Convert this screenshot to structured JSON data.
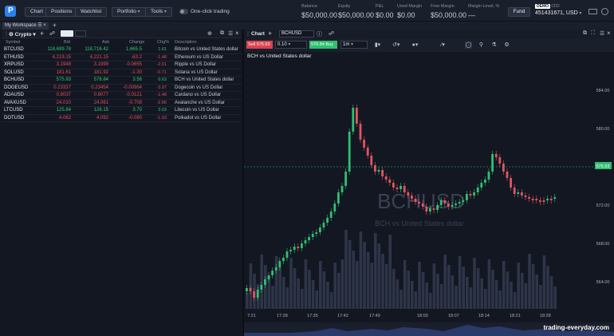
{
  "topbar": {
    "logo": "P",
    "nav": [
      "Chart",
      "Positions",
      "Watchlist"
    ],
    "portfolio": "Portfolio",
    "tools": "Tools",
    "one_click": "One-click trading",
    "balance_label": "Balance",
    "balance": "$50,000.00",
    "equity_label": "Equity",
    "equity": "$50,000.00",
    "pnl_label": "P&L",
    "pnl": "$0.00",
    "used_margin_label": "Used Margin",
    "used_margin": "$0.00",
    "free_margin_label": "Free Margin",
    "free_margin": "$50,000.00",
    "margin_level_label": "Margin Level, %",
    "margin_level": "—",
    "fund": "Fund",
    "demo_badge": "DEMO",
    "demo_suffix": "CFD",
    "account": "451431671, USD"
  },
  "workspace": {
    "tab": "My Workspace"
  },
  "watchlist": {
    "title": "Crypto",
    "columns": [
      "Symbol",
      "Bid",
      "Ask",
      "Change",
      "Chg%",
      "Description"
    ],
    "rows": [
      {
        "symbol": "BTCUSD",
        "bid": "118,699.78",
        "ask": "118,716.42",
        "change": "1,665.5",
        "chg": "1.61",
        "desc": "Bitcoin vs United States dollar",
        "up": true
      },
      {
        "symbol": "ETHUSD",
        "bid": "4,219.15",
        "ask": "4,221.15",
        "change": "-63.2",
        "chg": "-1.48",
        "desc": "Ethereum vs US Dollar",
        "up": false
      },
      {
        "symbol": "XRPUSD",
        "bid": "3.1948",
        "ask": "3.1999",
        "change": "-0.0655",
        "chg": "-2.01",
        "desc": "Ripple vs US Dollar",
        "up": false
      },
      {
        "symbol": "SOLUSD",
        "bid": "181.61",
        "ask": "181.92",
        "change": "-1.30",
        "chg": "-0.71",
        "desc": "Solana vs US Dollar",
        "up": false
      },
      {
        "symbol": "BCHUSD",
        "bid": "575.93",
        "ask": "576.84",
        "change": "3.56",
        "chg": "0.63",
        "desc": "BCH vs United States dollar",
        "up": true
      },
      {
        "symbol": "DOGEUSD",
        "bid": "0.23337",
        "ask": "0.23454",
        "change": "-0.00964",
        "chg": "-3.97",
        "desc": "Dogecoin vs US Dollar",
        "up": false
      },
      {
        "symbol": "ADAUSD",
        "bid": "0.8037",
        "ask": "0.8077",
        "change": "-0.0121",
        "chg": "-1.48",
        "desc": "Cardano vs US Dollar",
        "up": false
      },
      {
        "symbol": "AVAXUSD",
        "bid": "24.010",
        "ask": "24.061",
        "change": "-0.708",
        "chg": "-2.86",
        "desc": "Avalanche vs US Dollar",
        "up": false
      },
      {
        "symbol": "LTCUSD",
        "bid": "125.84",
        "ask": "126.15",
        "change": "3.70",
        "chg": "3.03",
        "desc": "Litecoin vs US Dollar",
        "up": true
      },
      {
        "symbol": "DOTUSD",
        "bid": "4.062",
        "ask": "4.092",
        "change": "-0.080",
        "chg": "-1.93",
        "desc": "Polkadot vs US Dollar",
        "up": false
      }
    ]
  },
  "chart": {
    "panel_title": "Chart",
    "symbol": "BCHUSD",
    "sell": "Sell 575.93",
    "quantity": "0.10",
    "buy": "576.84 Buy",
    "timeframe": "1m",
    "legend": "BCH vs United States dollar",
    "watermark_symbol": "BCHUSD",
    "watermark_desc": "BCH vs United States dollar",
    "last_price": "575.93",
    "y_ticks": [
      "584.00",
      "580.00",
      "576.00",
      "572.00",
      "568.00",
      "564.00"
    ],
    "x_ticks": [
      "7:21",
      "17:28",
      "17:35",
      "17:42",
      "17:49",
      "18:00",
      "18:07",
      "18:14",
      "18:21",
      "18:28"
    ]
  },
  "branding": "trading-everyday.com"
}
